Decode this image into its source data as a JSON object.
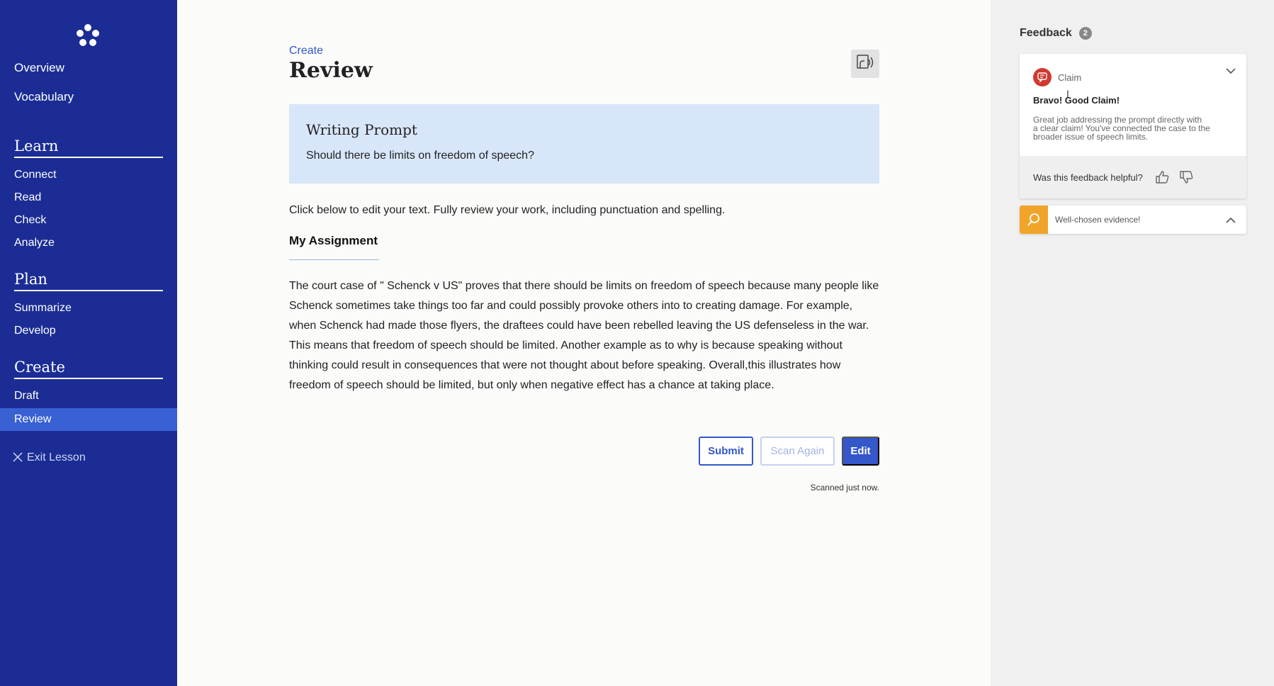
{
  "sidebar": {
    "top_items": [
      "Overview",
      "Vocabulary"
    ],
    "sections": [
      {
        "title": "Learn",
        "items": [
          "Connect",
          "Read",
          "Check",
          "Analyze"
        ]
      },
      {
        "title": "Plan",
        "items": [
          "Summarize",
          "Develop"
        ]
      },
      {
        "title": "Create",
        "items": [
          "Draft"
        ]
      }
    ],
    "active_item": "Review",
    "exit_label": "Exit Lesson"
  },
  "main": {
    "breadcrumb": "Create",
    "title": "Review",
    "prompt": {
      "heading": "Writing Prompt",
      "question": "Should there be limits on freedom of speech?"
    },
    "instructions": "Click below to edit your text. Fully review your work, including punctuation and spelling.",
    "assignment_heading": "My Assignment",
    "essay_lines": [
      "The court case of \" Schenck v US\" proves that there should be limits on freedom of speech because many people like",
      "Schenck sometimes take things too far and could possibly provoke others into to creating damage. For example,",
      "when Schenck had made those flyers, the draftees could have been rebelled leaving the US defenseless in the war.",
      "This means that freedom of speech should be limited. Another example as to why is because speaking without",
      "thinking could result in consequences that were not thought about before speaking. Overall,this illustrates how",
      "freedom of speech should be limited, but only when negative effect has a chance at taking place."
    ],
    "buttons": {
      "submit": "Submit",
      "scan_again": "Scan Again",
      "edit": "Edit"
    },
    "scan_status": "Scanned just now."
  },
  "feedback": {
    "title": "Feedback",
    "count": "2",
    "card1": {
      "type": "Claim",
      "title": "Bravo! Good Claim!",
      "body_lines": [
        "Great job addressing the prompt directly with",
        "a clear claim! You've connected the case to the",
        "broader issue of speech limits."
      ],
      "helpful_question": "Was this feedback helpful?"
    },
    "card2": {
      "label": "Well-chosen evidence!"
    }
  },
  "colors": {
    "sidebar_bg": "#1b2d94",
    "active_nav": "#3961d4",
    "accent": "#3457c9",
    "prompt_bg": "#d8e6fa",
    "claim_icon": "#d1392e",
    "evidence_icon": "#f0a42a"
  },
  "icons": {
    "logo": "flower-dots-logo",
    "audio": "read-aloud-icon",
    "exit": "close-icon",
    "claim": "chat-bubble-icon",
    "evidence": "magnifier-icon",
    "thumbs_up": "thumbs-up-icon",
    "thumbs_down": "thumbs-down-icon"
  }
}
